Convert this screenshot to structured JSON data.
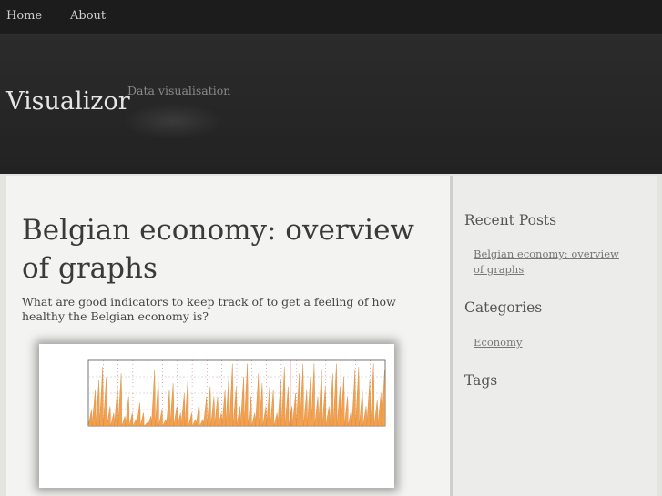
{
  "nav": {
    "items": [
      {
        "label": "Home"
      },
      {
        "label": "About"
      }
    ]
  },
  "header": {
    "title": "Visualizor",
    "description": "Data visualisation"
  },
  "post": {
    "title": "Belgian economy: overview of graphs",
    "intro": "What are good indicators to keep track of to get a feeling of how healthy the Belgian economy is?"
  },
  "sidebar": {
    "recent_heading": "Recent Posts",
    "recent_items": [
      {
        "label": "Belgian economy: overview of graphs"
      }
    ],
    "categories_heading": "Categories",
    "category_items": [
      {
        "label": "Economy"
      }
    ],
    "tags_heading": "Tags"
  },
  "chart_data": {
    "type": "area",
    "values": [
      0.25,
      0.55,
      0.7,
      0.9,
      0.75,
      0.3,
      0.2,
      0.6,
      0.8,
      0.15,
      0.45,
      0.2,
      0.1,
      0.35,
      0.2,
      0.05,
      0.15,
      0.85,
      0.7,
      0.25,
      0.1,
      0.55,
      0.65,
      0.3,
      0.2,
      0.5,
      0.75,
      0.2,
      0.1,
      0.35,
      0.1,
      0.45,
      0.6,
      0.45,
      0.45,
      0.2,
      0.55,
      0.75,
      0.95,
      0.6,
      0.3,
      0.75,
      0.95,
      0.45,
      0.2,
      0.8,
      0.65,
      0.3,
      0.6,
      0.55,
      0.2,
      0.7,
      0.9,
      0.6,
      0.3,
      0.5,
      0.8,
      0.95,
      0.55,
      0.75,
      0.95,
      0.45,
      0.85,
      0.6,
      0.3,
      0.8,
      0.95,
      0.6,
      0.75,
      0.45,
      0.25,
      0.85,
      0.9,
      0.55,
      0.3,
      0.7,
      0.95,
      0.4,
      0.5,
      0.85
    ],
    "color": "#f4a04c",
    "colors": {
      "area": "#f4a04c",
      "outline": "#c47a30",
      "marker": "#d01010"
    }
  }
}
